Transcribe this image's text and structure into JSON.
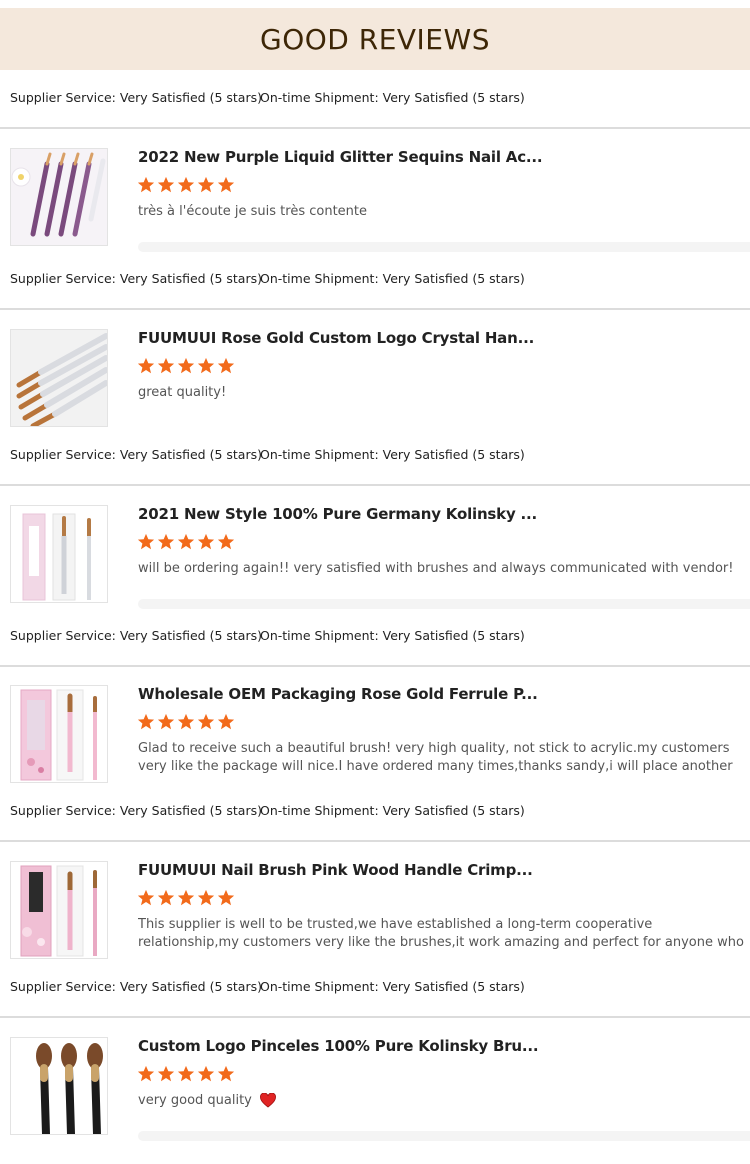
{
  "header": {
    "title": "GOOD REVIEWS"
  },
  "summary": {
    "supplier_service": "Supplier Service: Very Satisfied (5 stars)",
    "ontime_shipment": "On-time Shipment: Very Satisfied (5 stars)"
  },
  "colors": {
    "star": "#f26a1b",
    "header_bg": "#f4e8dc",
    "header_text": "#3d2606",
    "heart": "#e02424"
  },
  "reviews": [
    {
      "title": "2022 New Purple Liquid Glitter Sequins Nail Ac...",
      "stars": 5,
      "text": "très à l'écoute je suis très contente",
      "thumb_icon": "purple-glitter-brushes-image"
    },
    {
      "title": "FUUMUUI Rose Gold Custom Logo Crystal Han...",
      "stars": 5,
      "text": "great quality!",
      "thumb_icon": "rose-gold-crystal-brushes-image"
    },
    {
      "title": "2021 New Style 100% Pure Germany Kolinsky ...",
      "stars": 5,
      "text": "will be ordering again!! very satisfied with brushes and always communicated with vendor!",
      "thumb_icon": "kolinsky-brush-box-image"
    },
    {
      "title": "Wholesale OEM Packaging Rose Gold Ferrule P...",
      "stars": 5,
      "text": "Glad to receive such a beautiful brush! very high quality, not stick to acrylic.my customers very like the package will nice.I have ordered many times,thanks sandy,i will place another order after I sell them",
      "thumb_icon": "custom-packaging-brush-image"
    },
    {
      "title": "FUUMUUI Nail Brush Pink Wood Handle Crimp...",
      "stars": 5,
      "text": "This supplier is well to be trusted,we have established a long-term cooperative relationship,my customers very like the brushes,it work amazing and perfect for anyone who love's to do acrylic nails.",
      "thumb_icon": "pink-wood-brush-box-image"
    },
    {
      "title": "Custom Logo Pinceles 100% Pure Kolinsky Bru...",
      "stars": 5,
      "text": "very good quality",
      "thumb_icon": "black-handle-brushes-image",
      "emoji": "heart-icon"
    }
  ]
}
